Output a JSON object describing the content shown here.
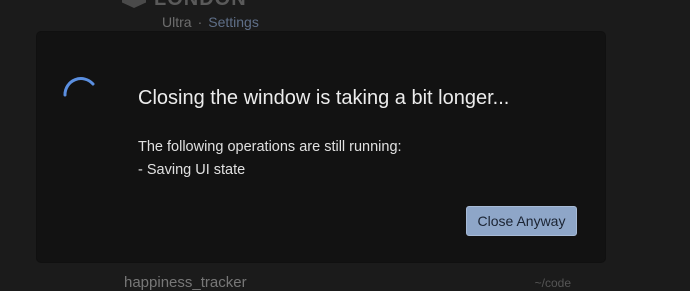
{
  "background": {
    "brand": "LONDON",
    "breadcrumb": {
      "item1": "Ultra",
      "separator": "·",
      "item2": "Settings"
    },
    "project_row": {
      "name": "happiness_tracker",
      "path": "~/code"
    }
  },
  "dialog": {
    "title": "Closing the window is taking a bit longer...",
    "body_line1": "The following operations are still running:",
    "body_line2": "- Saving UI state",
    "close_button_label": "Close Anyway",
    "spinner_icon": "loading-spinner-icon",
    "accent_color": "#5b8fe0",
    "button_color": "#8ea6c8"
  }
}
